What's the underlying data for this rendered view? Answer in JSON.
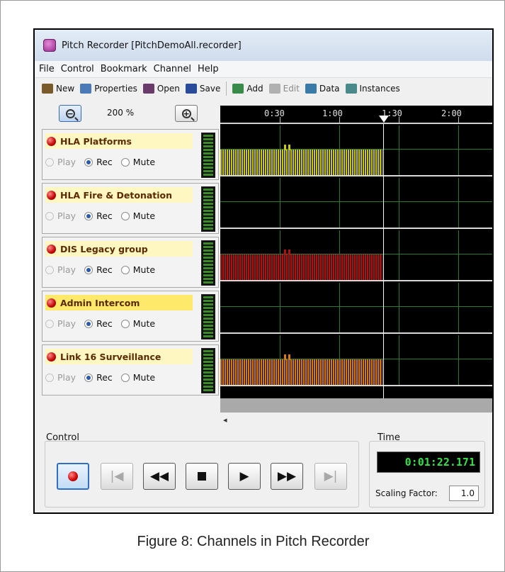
{
  "window": {
    "title": "Pitch Recorder [PitchDemoAll.recorder]"
  },
  "menu": [
    "File",
    "Control",
    "Bookmark",
    "Channel",
    "Help"
  ],
  "toolbar": [
    {
      "label": "New",
      "icon": "new-icon",
      "color": "#7a5a2a",
      "enabled": true
    },
    {
      "label": "Properties",
      "icon": "properties-icon",
      "color": "#4a7ab8",
      "enabled": true
    },
    {
      "label": "Open",
      "icon": "open-folder-icon",
      "color": "#6a3a6a",
      "enabled": true
    },
    {
      "label": "Save",
      "icon": "save-icon",
      "color": "#2a4a9a",
      "enabled": true
    },
    {
      "label": "Add",
      "icon": "add-icon",
      "color": "#3a8a4a",
      "enabled": true
    },
    {
      "label": "Edit",
      "icon": "edit-icon",
      "color": "#b0b0b0",
      "enabled": false
    },
    {
      "label": "Data",
      "icon": "data-icon",
      "color": "#3a7aa8",
      "enabled": true
    },
    {
      "label": "Instances",
      "icon": "instances-icon",
      "color": "#4a8a8a",
      "enabled": true
    }
  ],
  "zoom": {
    "level": "200 %"
  },
  "channels": [
    {
      "name": "HLA Platforms",
      "play": "Play",
      "rec": "Rec",
      "mute": "Mute",
      "selected": "rec",
      "active": false,
      "data_color": "#c8c814"
    },
    {
      "name": "HLA Fire & Detonation",
      "play": "Play",
      "rec": "Rec",
      "mute": "Mute",
      "selected": "rec",
      "active": false,
      "data_color": null
    },
    {
      "name": "DIS Legacy group",
      "play": "Play",
      "rec": "Rec",
      "mute": "Mute",
      "selected": "rec",
      "active": false,
      "data_color": "#b01010"
    },
    {
      "name": "Admin Intercom",
      "play": "Play",
      "rec": "Rec",
      "mute": "Mute",
      "selected": "rec",
      "active": true,
      "data_color": null
    },
    {
      "name": "Link 16 Surveillance",
      "play": "Play",
      "rec": "Rec",
      "mute": "Mute",
      "selected": "rec",
      "active": false,
      "data_color": "#d47a10"
    }
  ],
  "timeline": {
    "ticks": [
      "0:30",
      "1:00",
      "1:30",
      "2:00"
    ]
  },
  "control": {
    "label": "Control"
  },
  "time": {
    "label": "Time",
    "value": "0:01:22.171",
    "scaling_label": "Scaling Factor:",
    "scaling_value": "1.0"
  },
  "caption": "Figure 8: Channels in Pitch Recorder",
  "colors": {
    "grid": "#2e7a2e",
    "time_text": "#37e04a"
  }
}
